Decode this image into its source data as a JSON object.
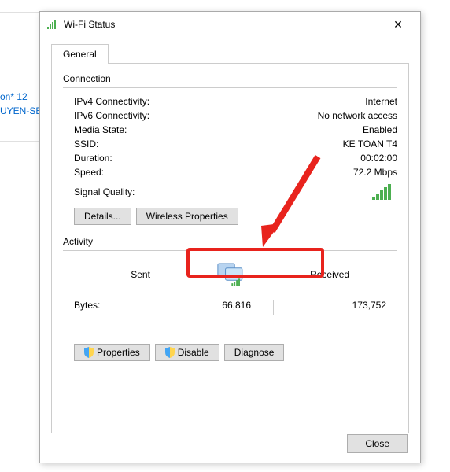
{
  "background": {
    "line1": "on* 12",
    "line2": "UYEN-SEO"
  },
  "dialog": {
    "title": "Wi-Fi Status",
    "tabs": {
      "general": "General"
    },
    "connection": {
      "label": "Connection",
      "ipv4_label": "IPv4 Connectivity:",
      "ipv4_value": "Internet",
      "ipv6_label": "IPv6 Connectivity:",
      "ipv6_value": "No network access",
      "media_label": "Media State:",
      "media_value": "Enabled",
      "ssid_label": "SSID:",
      "ssid_value": "KE TOAN T4",
      "duration_label": "Duration:",
      "duration_value": "00:02:00",
      "speed_label": "Speed:",
      "speed_value": "72.2 Mbps",
      "signal_label": "Signal Quality:"
    },
    "buttons": {
      "details": "Details...",
      "wireless_properties": "Wireless Properties"
    },
    "activity": {
      "label": "Activity",
      "sent": "Sent",
      "received": "Received",
      "bytes_label": "Bytes:",
      "bytes_sent": "66,816",
      "bytes_received": "173,752"
    },
    "buttons2": {
      "properties": "Properties",
      "disable": "Disable",
      "diagnose": "Diagnose"
    },
    "close": "Close"
  }
}
